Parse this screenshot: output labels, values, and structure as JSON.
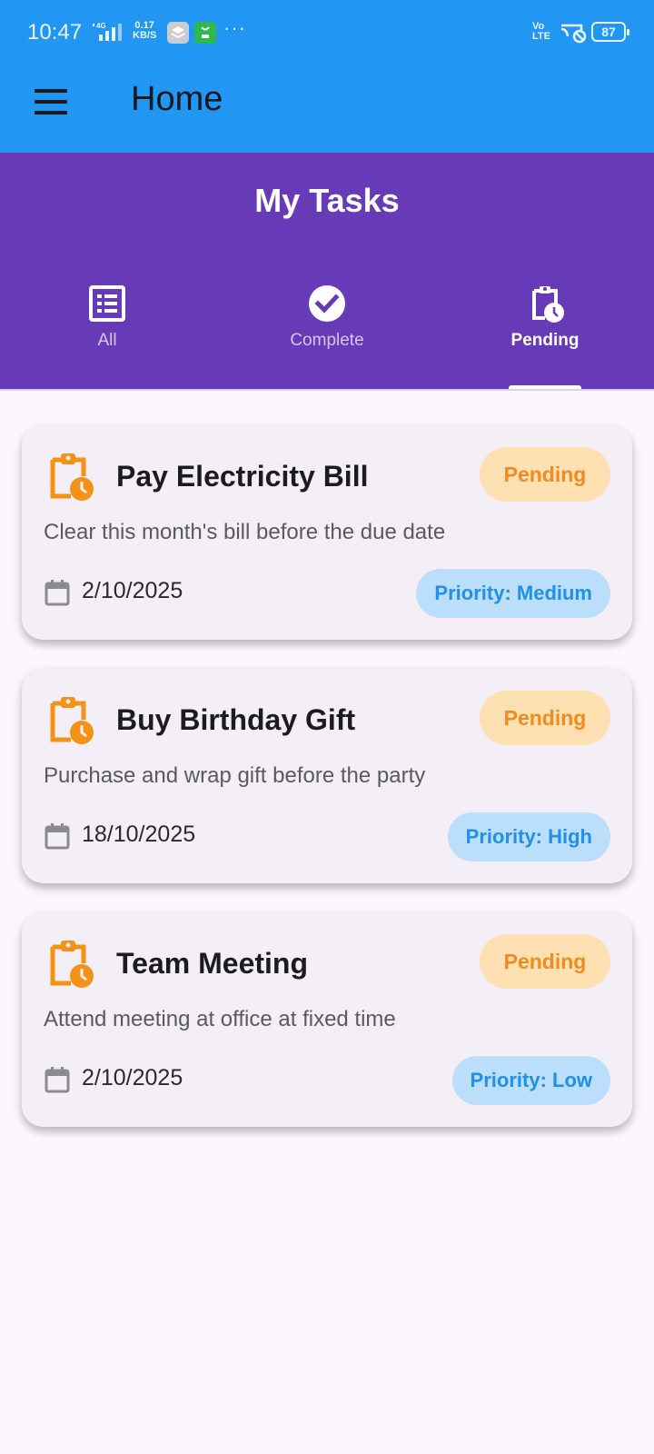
{
  "status_bar": {
    "time": "10:47",
    "network_type": "4G",
    "speed_value": "0.17",
    "speed_unit": "KB/S",
    "more": "···",
    "volte_top": "Vo",
    "volte_bottom": "LTE",
    "battery": "87"
  },
  "app_bar": {
    "title": "Home",
    "menu_icon": "hamburger-menu-icon",
    "color": "#2196f3"
  },
  "header": {
    "title": "My Tasks",
    "color": "#673ab7",
    "tabs": [
      {
        "label": "All",
        "icon": "list-icon",
        "active": false
      },
      {
        "label": "Complete",
        "icon": "check-circle-icon",
        "active": false
      },
      {
        "label": "Pending",
        "icon": "pending-clipboard-icon",
        "active": true
      }
    ]
  },
  "tasks": [
    {
      "title": "Pay Electricity Bill",
      "status": "Pending",
      "description": "Clear this month's bill before the due date",
      "date": "2/10/2025",
      "priority": "Priority: Medium"
    },
    {
      "title": "Buy Birthday Gift",
      "status": "Pending",
      "description": "Purchase and wrap gift before the party",
      "date": "18/10/2025",
      "priority": "Priority: High"
    },
    {
      "title": "Team Meeting",
      "status": "Pending",
      "description": "Attend meeting at office at fixed time",
      "date": "2/10/2025",
      "priority": "Priority: Low"
    }
  ],
  "colors": {
    "pending_text": "#ef8c1f",
    "pending_bg": "#ffe0b2",
    "priority_text": "#2190e6",
    "priority_bg": "#bbdefb",
    "task_icon": "#f39214"
  }
}
